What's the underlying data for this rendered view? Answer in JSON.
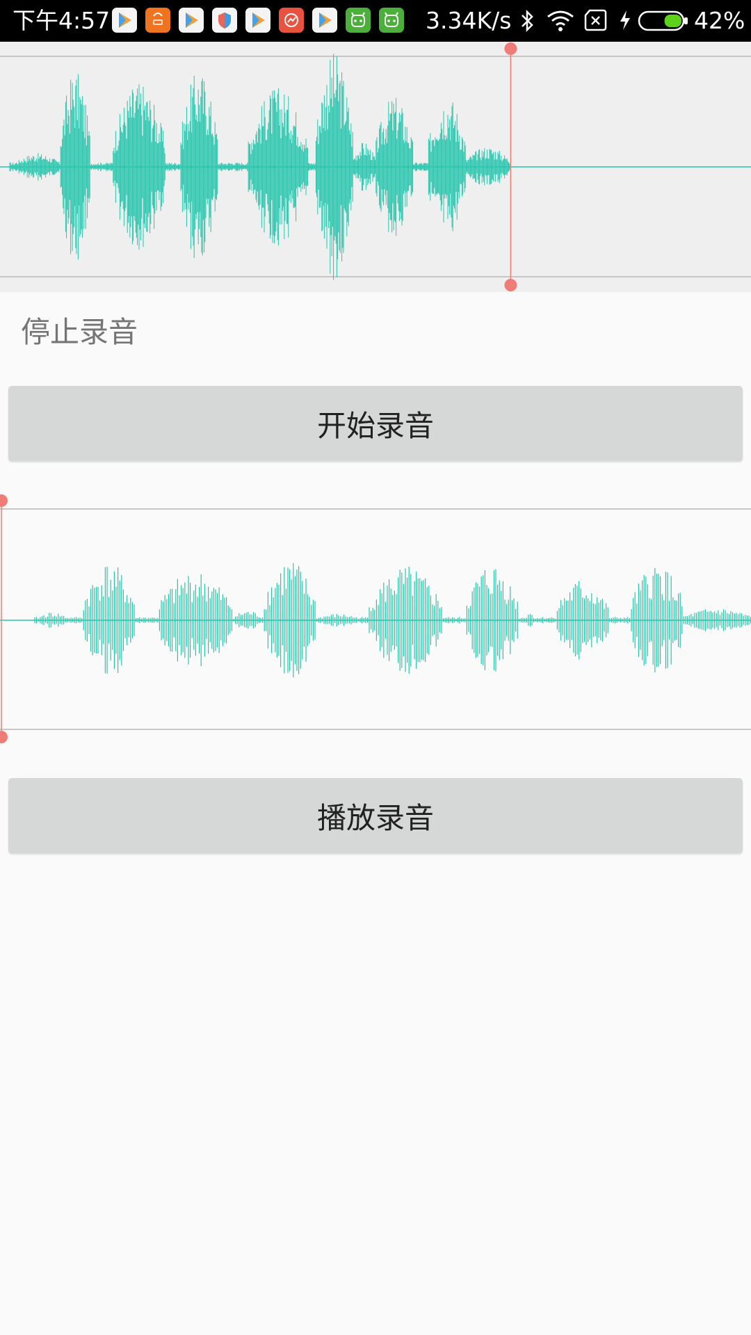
{
  "status_bar": {
    "time": "下午4:57",
    "network_speed": "3.34K/s",
    "battery_percent": "42%",
    "battery_level": 0.42,
    "notification_icons": [
      {
        "name": "play-store-icon",
        "bg": "#f4f4f4"
      },
      {
        "name": "mi-store-icon",
        "bg": "#f0731f"
      },
      {
        "name": "play-store-icon",
        "bg": "#f4f4f4"
      },
      {
        "name": "shield-app-icon",
        "bg": "#f4f4f4"
      },
      {
        "name": "play-store-icon",
        "bg": "#f4f4f4"
      },
      {
        "name": "red-app-icon",
        "bg": "#e8523e"
      },
      {
        "name": "play-store-icon",
        "bg": "#f4f4f4"
      },
      {
        "name": "android-app-icon",
        "bg": "#4caf3b"
      },
      {
        "name": "android-app-icon",
        "bg": "#4caf3b"
      }
    ]
  },
  "recording_status": "停止录音",
  "buttons": {
    "record": "开始录音",
    "play": "播放录音"
  },
  "colors": {
    "waveform": "#26c6ad",
    "cursor": "#f07c78",
    "button_bg": "#d6d7d7",
    "page_bg": "#fafafa"
  },
  "waveforms": {
    "recording": {
      "progress": 0.68,
      "bursts": [
        [
          0.02,
          0.08,
          0.12
        ],
        [
          0.08,
          0.12,
          0.85
        ],
        [
          0.15,
          0.22,
          0.75
        ],
        [
          0.24,
          0.29,
          0.85
        ],
        [
          0.33,
          0.41,
          0.7
        ],
        [
          0.42,
          0.47,
          1.0
        ],
        [
          0.47,
          0.5,
          0.22
        ],
        [
          0.5,
          0.55,
          0.62
        ],
        [
          0.57,
          0.62,
          0.65
        ],
        [
          0.62,
          0.68,
          0.18
        ]
      ]
    },
    "playback": {
      "progress": 0.0,
      "bursts": [
        [
          0.05,
          0.09,
          0.1
        ],
        [
          0.11,
          0.18,
          0.7
        ],
        [
          0.21,
          0.31,
          0.6
        ],
        [
          0.31,
          0.35,
          0.12
        ],
        [
          0.35,
          0.42,
          0.75
        ],
        [
          0.42,
          0.48,
          0.08
        ],
        [
          0.49,
          0.59,
          0.65
        ],
        [
          0.62,
          0.69,
          0.7
        ],
        [
          0.7,
          0.71,
          0.12
        ],
        [
          0.74,
          0.81,
          0.5
        ],
        [
          0.84,
          0.91,
          0.7
        ],
        [
          0.91,
          1.0,
          0.15
        ]
      ]
    }
  }
}
